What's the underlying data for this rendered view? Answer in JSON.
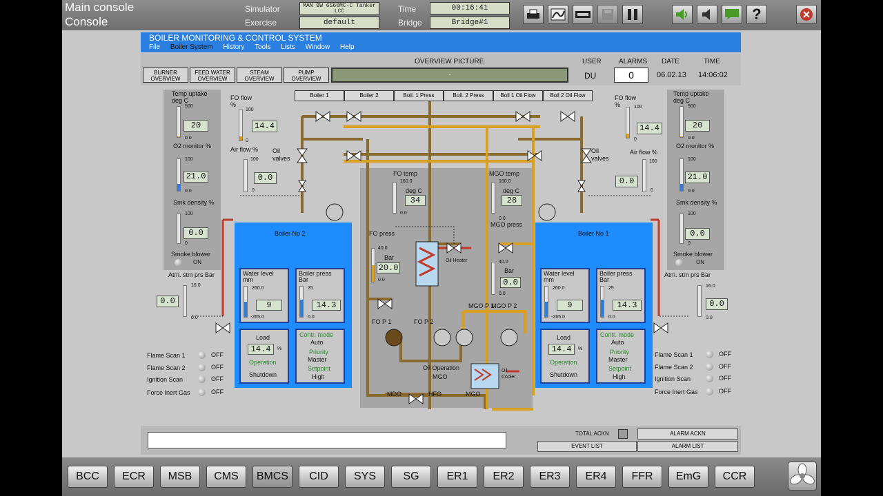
{
  "topbar": {
    "title1": "Main console",
    "title2": "Console",
    "simulator_label": "Simulator",
    "simulator_value": "MAN BW 6S60MC-C Tanker LCC",
    "exercise_label": "Exercise",
    "exercise_value": "default",
    "time_label": "Time",
    "time_value": "00:16:41",
    "bridge_label": "Bridge",
    "bridge_value": "Bridge#1"
  },
  "header": {
    "title": "BOILER MONITORING & CONTROL SYSTEM",
    "menu": [
      "File",
      "Boiler System",
      "History",
      "Tools",
      "Lists",
      "Window",
      "Help"
    ],
    "overview_buttons": [
      "BURNER OVERVIEW",
      "FEED WATER OVERVIEW",
      "STEAM OVERVIEW",
      "PUMP OVERVIEW"
    ],
    "overview_picture_label": "OVERVIEW PICTURE",
    "overview_picture_value": "-",
    "user_label": "USER",
    "user_value": "DU",
    "alarms_label": "ALARMS",
    "alarms_value": "0",
    "date_label": "DATE",
    "date_value": "06.02.13",
    "time_label": "TIME",
    "time_value": "14:06:02"
  },
  "tabs": [
    "Boiler 1",
    "Boiler 2",
    "Boil. 1 Press",
    "Boil. 2 Press",
    "Boil 1 Oil Flow",
    "Boil 2 Oil Flow"
  ],
  "left": {
    "temp_uptake_label": "Temp uptake deg C",
    "temp_uptake_max": "500",
    "temp_uptake_min": "0.0",
    "temp_uptake_value": "20",
    "o2_label": "O2 monitor %",
    "o2_max": "100",
    "o2_min": "0.0",
    "o2_value": "21.0",
    "smk_label": "Smk density %",
    "smk_max": "100",
    "smk_min": "0",
    "smk_value": "0.0",
    "smoke_blower_label": "Smoke blower",
    "smoke_blower_state": "ON",
    "atm_label": "Atm. stm prs Bar",
    "atm_max": "16.0",
    "atm_min": "0.0",
    "atm_value": "0.0",
    "fo_flow_label": "FO flow %",
    "fo_flow_max": "100",
    "fo_flow_min": "0",
    "fo_flow_value": "14.4",
    "air_flow_label": "Air flow %",
    "air_flow_max": "100",
    "air_flow_min": "0",
    "air_flow_value": "0.0",
    "oil_valves_label": "Oil valves",
    "scan": [
      {
        "label": "Flame Scan  1",
        "state": "OFF"
      },
      {
        "label": "Flame Scan  2",
        "state": "OFF"
      },
      {
        "label": "Ignition Scan",
        "state": "OFF"
      },
      {
        "label": "Force Inert Gas",
        "state": "OFF"
      }
    ]
  },
  "right": {
    "temp_uptake_label": "Temp uptake deg C",
    "temp_uptake_max": "500",
    "temp_uptake_min": "0.0",
    "temp_uptake_value": "20",
    "o2_label": "O2 monitor %",
    "o2_max": "100",
    "o2_min": "0.0",
    "o2_value": "21.0",
    "smk_label": "Smk density %",
    "smk_max": "100",
    "smk_min": "0",
    "smk_value": "0.0",
    "smoke_blower_label": "Smoke blower",
    "smoke_blower_state": "ON",
    "atm_label": "Atm. stm prs Bar",
    "atm_max": "16.0",
    "atm_min": "0.0",
    "atm_value": "0.0",
    "fo_flow_label": "FO flow %",
    "fo_flow_max": "100",
    "fo_flow_min": "0",
    "fo_flow_value": "14.4",
    "air_flow_label": "Air flow %",
    "air_flow_max": "100",
    "air_flow_min": "0",
    "air_flow_value": "0.0",
    "oil_valves_label": "Oil valves",
    "scan": [
      {
        "label": "Flame Scan  1",
        "state": "OFF"
      },
      {
        "label": "Flame Scan  2",
        "state": "OFF"
      },
      {
        "label": "Ignition Scan",
        "state": "OFF"
      },
      {
        "label": "Force Inert Gas",
        "state": "OFF"
      }
    ]
  },
  "boiler2": {
    "title": "Boiler No 2",
    "water_label": "Water level mm",
    "water_max": "260.0",
    "water_min": "-265.0",
    "water_value": "9",
    "press_label": "Boiler press Bar",
    "press_max": "25",
    "press_min": "0.0",
    "press_value": "14.3",
    "load_label": "Load",
    "load_value": "14.4",
    "load_unit": "%",
    "operation_label": "Operation",
    "operation_value": "Shutdown",
    "contr_label": "Contr. mode",
    "contr_value": "Auto",
    "priority_label": "Priority",
    "priority_value": "Master",
    "setpoint_label": "Setpoint",
    "setpoint_value": "High"
  },
  "boiler1": {
    "title": "Boiler No 1",
    "water_label": "Water level mm",
    "water_max": "260.0",
    "water_min": "-265.0",
    "water_value": "9",
    "press_label": "Boiler press Bar",
    "press_max": "25",
    "press_min": "0.0",
    "press_value": "14.3",
    "load_label": "Load",
    "load_value": "14.4",
    "load_unit": "%",
    "operation_label": "Operation",
    "operation_value": "Shutdown",
    "contr_label": "Contr. mode",
    "contr_value": "Auto",
    "priority_label": "Priority",
    "priority_value": "Master",
    "setpoint_label": "Setpoint",
    "setpoint_value": "High"
  },
  "center": {
    "fo_temp_label": "FO temp",
    "fo_temp_max": "160.0",
    "fo_temp_unit": "deg C",
    "fo_temp_value": "34",
    "fo_temp_min": "0.0",
    "mgo_temp_label": "MGO temp",
    "mgo_temp_max": "160.0",
    "mgo_temp_unit": "deg C",
    "mgo_temp_value": "28",
    "mgo_temp_min": "0.0",
    "fo_press_label": "FO press",
    "fo_press_max": "40.0",
    "fo_press_unit": "Bar",
    "fo_press_value": "20.0",
    "fo_press_min": "0.0",
    "mgo_press_label": "MGO press",
    "mgo_press_max": "40.0",
    "mgo_press_unit": "Bar",
    "mgo_press_value": "0.0",
    "mgo_press_min": "0.0",
    "oil_heater_label": "Oil Heater",
    "oil_cooler_label": "Oil Cooler",
    "fop1": "FO P 1",
    "fop2": "FO P 2",
    "mgop1": "MGO P 1",
    "mgop2": "MGO P 2",
    "oil_operation_label": "Oil Operation",
    "oil_operation_value": "MGO",
    "mdo": "MDO",
    "hfo": "HFO",
    "mgo": "MGO"
  },
  "ack": {
    "total": "TOTAL ACKN",
    "alarm_ackn": "ALARM ACKN",
    "event_list": "EVENT LIST",
    "alarm_list": "ALARM LIST"
  },
  "nav": [
    "BCC",
    "ECR",
    "MSB",
    "CMS",
    "BMCS",
    "CID",
    "SYS",
    "SG",
    "ER1",
    "ER2",
    "ER3",
    "ER4",
    "FFR",
    "EmG",
    "CCR"
  ],
  "colors": {
    "boiler_blue": "#1e8cff",
    "fo_pipe": "#8b6a2e",
    "mgo_pipe": "#d9a020",
    "steam_pipe": "#c0392b"
  }
}
